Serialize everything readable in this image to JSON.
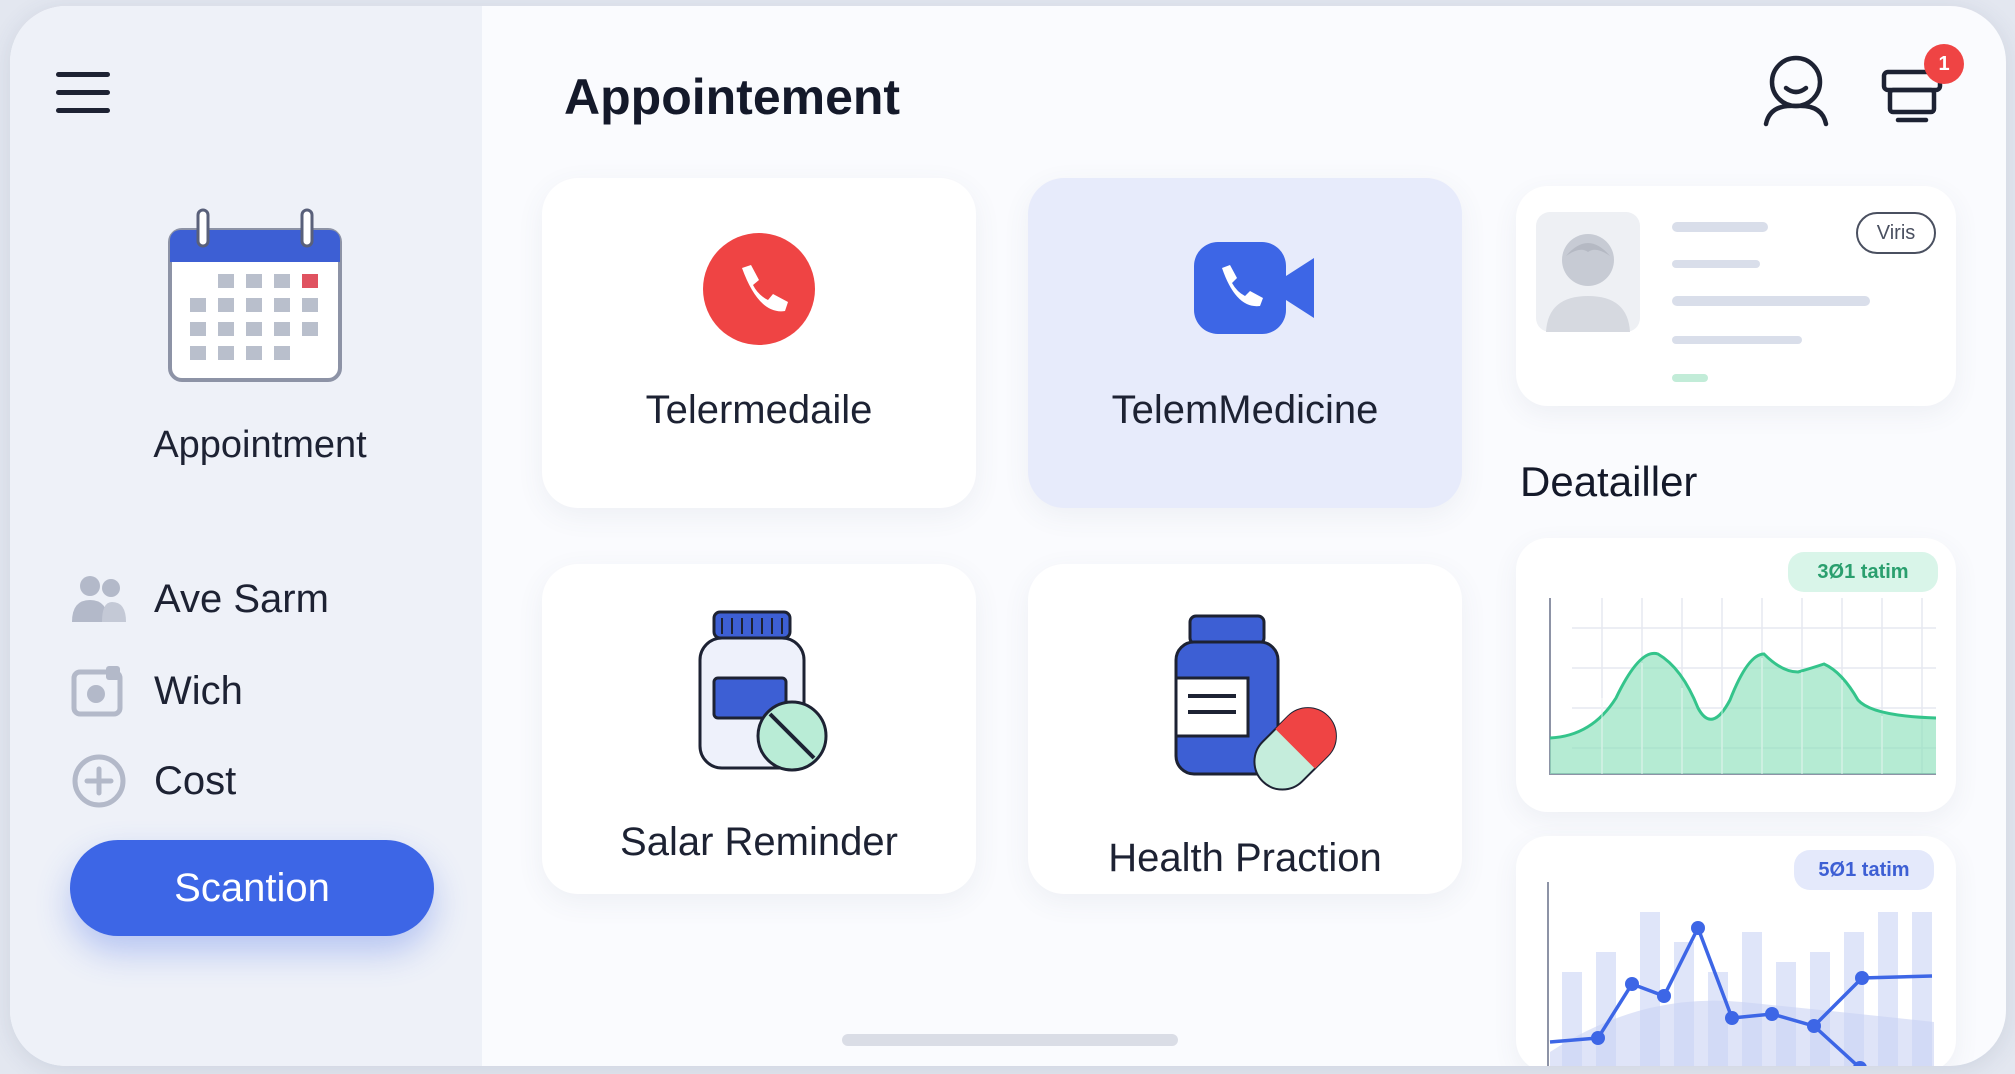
{
  "header": {
    "title": "Appointement",
    "notification_count": "1",
    "icons": [
      "menu-icon",
      "user-profile-icon",
      "notifications-icon"
    ]
  },
  "sidebar": {
    "title": "Appointment",
    "items": [
      {
        "label": "Ave Sarm",
        "icon": "people-icon"
      },
      {
        "label": "Wich",
        "icon": "photo-icon"
      },
      {
        "label": "Cost",
        "icon": "plus-circle-icon"
      }
    ],
    "cta_label": "Scantion"
  },
  "tiles": [
    {
      "label": "Telermedaile",
      "icon": "phone-call-icon"
    },
    {
      "label": "TelemMedicine",
      "icon": "video-call-icon",
      "active": true
    },
    {
      "label": "Salar Reminder",
      "icon": "pill-bottle-icon"
    },
    {
      "label": "Health Praction",
      "icon": "medication-icon"
    }
  ],
  "profile_card": {
    "status_pill": "Viris"
  },
  "details": {
    "title": "Deatailler",
    "charts": [
      {
        "chip_label": "3Ø1 tatim",
        "type": "area"
      },
      {
        "chip_label": "5Ø1 tatim",
        "type": "line"
      }
    ]
  },
  "colors": {
    "accent": "#3d66e6",
    "danger": "#ef4444",
    "success": "#34c48b",
    "sidebar_bg": "#eef1f8"
  }
}
